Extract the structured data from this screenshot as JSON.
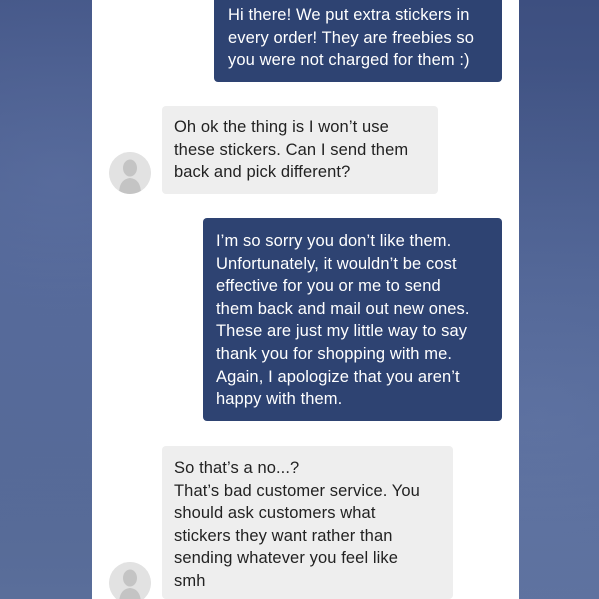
{
  "conversation": {
    "messages": [
      {
        "sender": "shop",
        "text": "Hi there! We put extra stickers in\nevery order! They are freebies so\nyou were not charged for them :)"
      },
      {
        "sender": "customer",
        "text": "Oh ok the thing is I won’t use\nthese stickers. Can I send them\nback and pick different?"
      },
      {
        "sender": "shop",
        "text": "I’m so sorry you don’t like them.\nUnfortunately, it wouldn’t be cost\neffective for you or me to send\nthem back and mail out new ones.\nThese are just my little way to say\nthank you for shopping with me.\nAgain, I apologize that you aren’t\nhappy with them."
      },
      {
        "sender": "customer",
        "text": "So that’s a no...?\nThat’s bad customer service. You\nshould ask customers what\nstickers they want rather than\nsending whatever you feel like\nsmh"
      }
    ],
    "avatar_icon": "user-silhouette-icon",
    "colors": {
      "outgoing_bubble": "#2e4372",
      "incoming_bubble": "#eeeeee",
      "panel_background": "#ffffff",
      "page_background": "#4b5f8f"
    }
  }
}
